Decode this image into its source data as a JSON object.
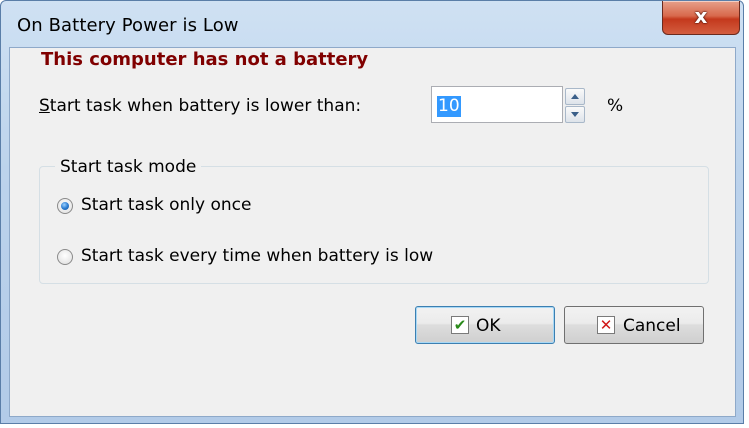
{
  "window": {
    "title": "On Battery Power is Low",
    "close_glyph": "x"
  },
  "warning_text": "This computer has not a battery",
  "threshold": {
    "label_first": "S",
    "label_rest": "tart task when battery is lower than:",
    "value": "10",
    "unit": "%"
  },
  "mode_group": {
    "legend": "Start task mode",
    "options": [
      {
        "label": "Start task only once",
        "selected": true
      },
      {
        "label": "Start task every time when battery is low",
        "selected": false
      }
    ]
  },
  "buttons": {
    "ok": {
      "label": "OK",
      "icon": "check-icon",
      "glyph": "✔"
    },
    "cancel": {
      "label": "Cancel",
      "icon": "x-icon",
      "glyph": "✕"
    }
  },
  "colors": {
    "warning": "#800000",
    "selection": "#3399ff",
    "close_button": "#c4391d"
  }
}
